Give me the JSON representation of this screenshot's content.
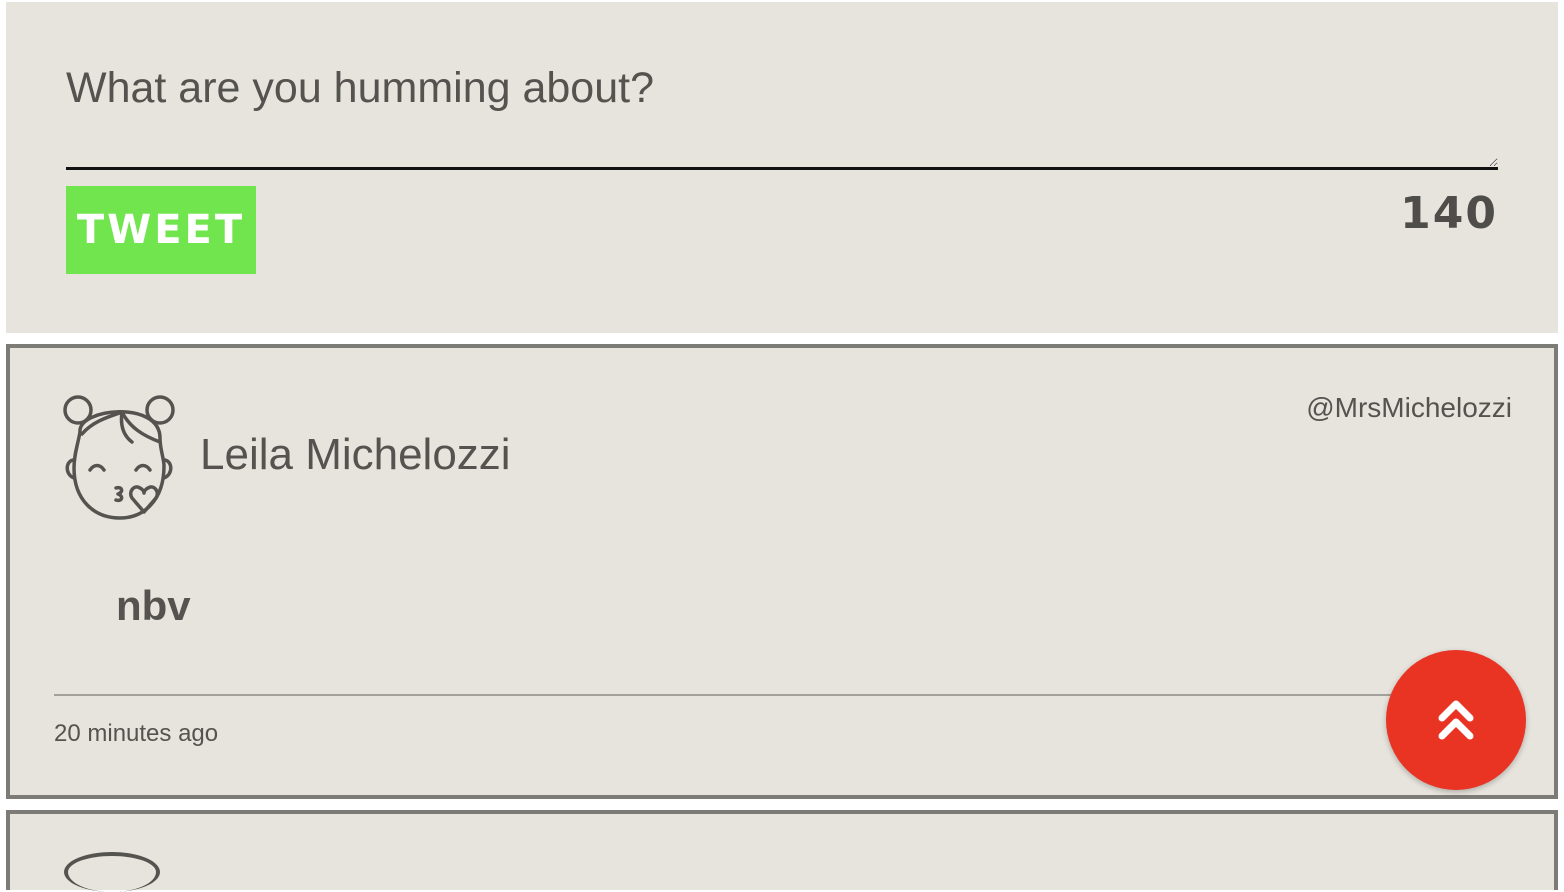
{
  "compose": {
    "placeholder": "What are you humming about?",
    "value": "",
    "tweet_button_label": "TWEET",
    "char_count": "140",
    "accent_color": "#71e54d"
  },
  "tweets": [
    {
      "author_name": "Leila Michelozzi",
      "author_handle": "@MrsMichelozzi",
      "text": "nbv",
      "timestamp": "20 minutes ago",
      "avatar_icon": "girl-blowing-kiss-icon"
    }
  ],
  "scroll_top": {
    "icon": "double-chevron-up-icon",
    "color": "#e93323"
  }
}
